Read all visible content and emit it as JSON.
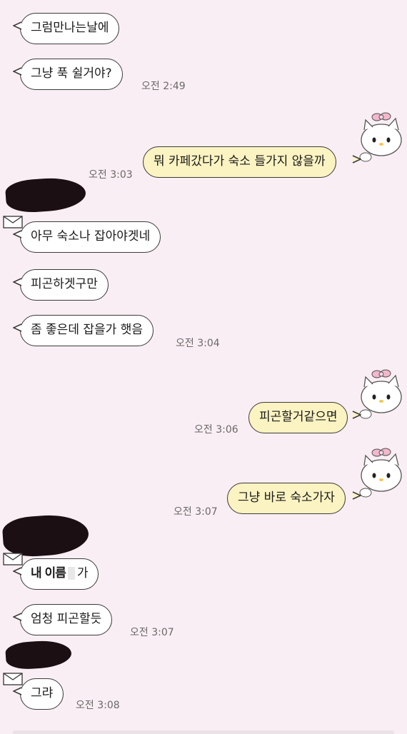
{
  "messages": [
    {
      "text": "그럼만나는날에"
    },
    {
      "text": "그냥 푹 쉴거야?",
      "time": "오전 2:49"
    },
    {
      "text": "뭐 카페갔다가 숙소 들가지 않을까",
      "time": "오전 3:03"
    },
    {
      "text": "아무 숙소나 잡아야겟네"
    },
    {
      "text": "피곤하겟구만"
    },
    {
      "text": "좀 좋은데 잡을가 햇음",
      "time": "오전 3:04"
    },
    {
      "text": "피곤할거같으면",
      "time": "오전 3:06"
    },
    {
      "text": "그냥 바로 숙소가자",
      "time": "오전 3:07"
    },
    {
      "text_a": "내 이름",
      "text_b": "가"
    },
    {
      "text": "엄청 피곤할듯",
      "time": "오전 3:07"
    },
    {
      "text": "그랴",
      "time": "오전 3:08"
    }
  ],
  "icons": {
    "envelope": "envelope-icon",
    "avatar": "hello-kitty-avatar"
  },
  "colors": {
    "background": "#f9eef3",
    "incoming_bubble": "#ffffff",
    "outgoing_bubble": "#fbf3c2",
    "border": "#3a3a3a"
  }
}
